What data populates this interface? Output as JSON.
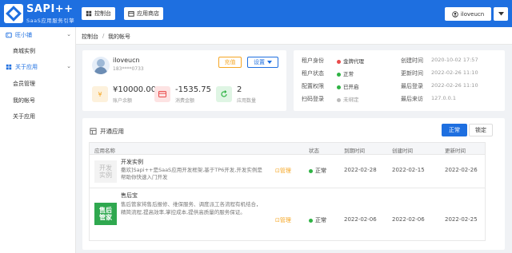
{
  "header": {
    "logo_title": "SAPI++",
    "logo_subtitle": "SaaS应用服务引擎",
    "nav": [
      {
        "label": "控制台",
        "icon": "dashboard-icon"
      },
      {
        "label": "应用商店",
        "icon": "store-icon"
      }
    ],
    "user_label": "iloveucn"
  },
  "sidebar": {
    "groups": [
      {
        "label": "旺小铺",
        "items": [
          "商城实例"
        ]
      },
      {
        "label": "关于应用",
        "items": [
          "会员管理",
          "我的帐号",
          "关于应用"
        ]
      }
    ]
  },
  "breadcrumb": [
    "控制台",
    "我的帐号"
  ],
  "profile": {
    "name": "iloveucn",
    "phone": "183****0733",
    "recharge_label": "充值",
    "settings_label": "设置",
    "stats": [
      {
        "value": "¥10000.00",
        "label": "账户余额",
        "icon": "yen-icon",
        "color": "#f5a623"
      },
      {
        "value": "-1535.75",
        "label": "消费金额",
        "icon": "card-icon",
        "color": "#e94b4b"
      },
      {
        "value": "2",
        "label": "应用数量",
        "icon": "refresh-icon",
        "color": "#2fb344"
      }
    ]
  },
  "info": {
    "left": [
      {
        "key": "租户身份",
        "value": "金牌代理",
        "dot": "#e94b4b"
      },
      {
        "key": "租户状态",
        "value": "正常",
        "dot": "#2fb344"
      },
      {
        "key": "配置权限",
        "value": "已开启",
        "dot": "#2fb344"
      },
      {
        "key": "扫码登录",
        "value": "未绑定",
        "dot": "#bbbbbb"
      }
    ],
    "right": [
      {
        "key": "创建时间",
        "value": "2020-10-02 17:57"
      },
      {
        "key": "更新时间",
        "value": "2022-02-26 11:10"
      },
      {
        "key": "最后登录",
        "value": "2022-02-26 11:10"
      },
      {
        "key": "最后来访",
        "value": "127.0.0.1"
      }
    ]
  },
  "apps_panel": {
    "title": "开通应用",
    "tab_normal": "正常",
    "tab_locked": "锁定",
    "columns": [
      "应用名称",
      "状态",
      "到期时间",
      "创建时间",
      "更新时间"
    ],
    "rows": [
      {
        "logo_text": "开发实例",
        "name": "开发实例",
        "desc": "撒欢]Sapi++是SaaS应用开发框架,基于TP6开发,开发实例是帮助你快速入门开发",
        "manage": "管理",
        "status": "正常",
        "expire": "2022-02-28",
        "created": "2022-02-15",
        "updated": "2022-02-26"
      },
      {
        "logo_text": "售后管家",
        "name": "售后宝",
        "desc": "售后管家将售后报修、维保服务、调度派工各流程有机结合，精简流程,提高效率,掌控成本,提供高质量的服务保证。",
        "manage": "管理",
        "status": "正常",
        "expire": "2022-02-06",
        "created": "2022-02-06",
        "updated": "2022-02-25"
      }
    ]
  }
}
